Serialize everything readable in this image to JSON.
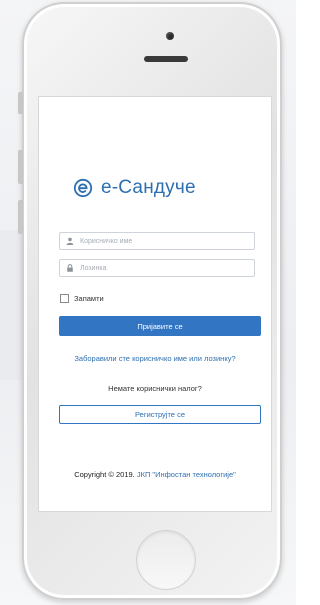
{
  "brand": {
    "name": "е-Сандуче",
    "color": "#2d6fb1"
  },
  "login": {
    "username_placeholder": "Корисничко име",
    "password_placeholder": "Лозинка",
    "remember_label": "Запамти",
    "submit_label": "Пријавите се",
    "forgot_link": "Заборавили сте корисничко име или лозинку?",
    "no_account_text": "Немате кориснички налог?",
    "register_label": "Региструјте се"
  },
  "footer": {
    "copyright": "Copyright © 2019.",
    "organization": "ЈКП \"Инфостан технологије\""
  },
  "icons": {
    "logo": "e-sanduce-logo-icon",
    "user": "user-icon",
    "lock": "lock-icon"
  },
  "colors": {
    "primary": "#3276c3"
  }
}
